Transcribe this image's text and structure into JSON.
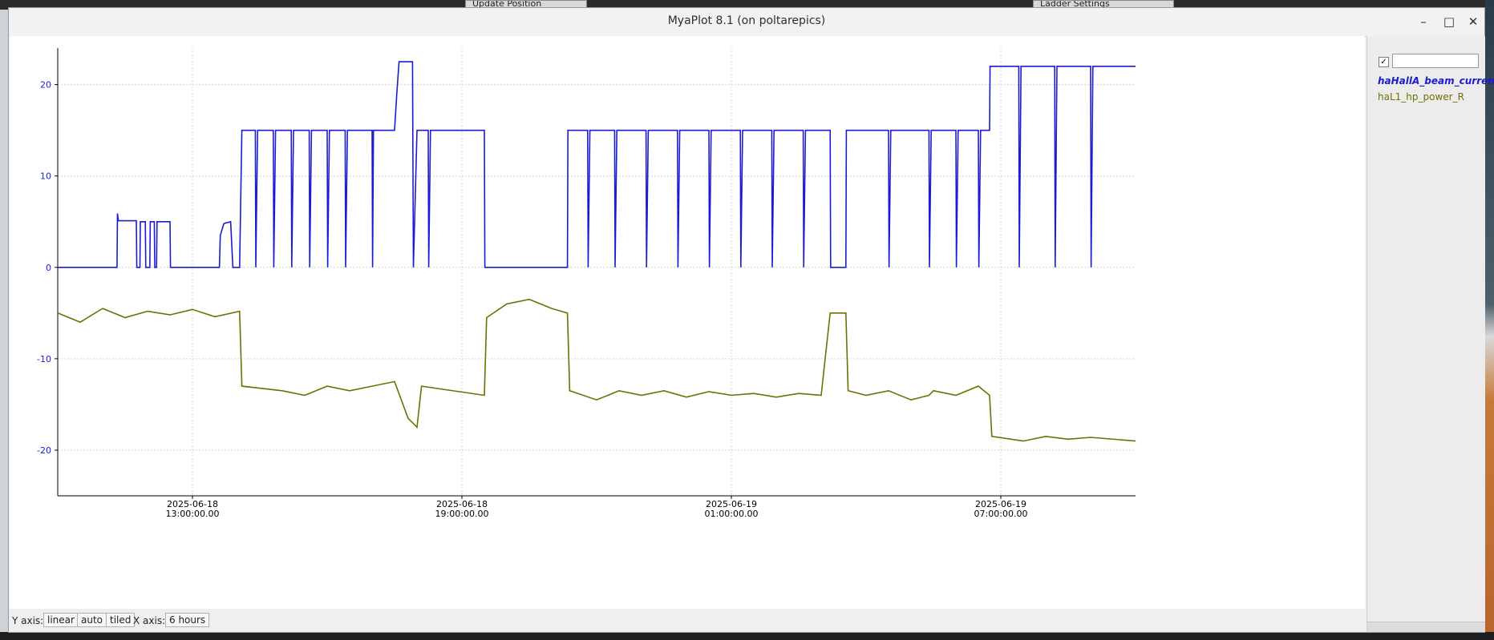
{
  "window": {
    "title": "MyaPlot 8.1 (on poltarepics)",
    "minimize_label": "–",
    "maximize_label": "□",
    "close_label": "✕"
  },
  "background": {
    "update_position_label": "Update Position",
    "ladder_settings_label": "Ladder Settings"
  },
  "legend": {
    "checked": true,
    "check_glyph": "✓",
    "filter_value": "",
    "items": [
      {
        "label": "haHallA_beam_curren",
        "color": "#1c1ccf",
        "selected": true
      },
      {
        "label": "haL1_hp_power_R",
        "color": "#707000",
        "selected": false
      }
    ]
  },
  "status": {
    "y_axis_label": "Y axis:",
    "y_scale": "linear",
    "y_range": "auto",
    "y_layout": "tiled",
    "x_axis_label": "X axis:",
    "x_span": "6 hours"
  },
  "chart_data": {
    "type": "line",
    "grid": true,
    "x_unit": "hours since 2025-06-18 10:00",
    "xlim": [
      0,
      24
    ],
    "ylim": [
      -25,
      24
    ],
    "y_ticks": [
      -20,
      -10,
      0,
      10,
      20
    ],
    "x_ticks": [
      {
        "x": 3,
        "date": "2025-06-18",
        "time": "13:00:00.00"
      },
      {
        "x": 9,
        "date": "2025-06-18",
        "time": "19:00:00.00"
      },
      {
        "x": 15,
        "date": "2025-06-19",
        "time": "01:00:00.00"
      },
      {
        "x": 21,
        "date": "2025-06-19",
        "time": "07:00:00.00"
      }
    ],
    "series": [
      {
        "name": "haHallA_beam_curren",
        "color": "#1c1ccf",
        "points": [
          [
            0,
            0
          ],
          [
            1.32,
            0
          ],
          [
            1.33,
            5.9
          ],
          [
            1.35,
            5.1
          ],
          [
            1.75,
            5.1
          ],
          [
            1.76,
            0
          ],
          [
            1.83,
            0
          ],
          [
            1.84,
            5
          ],
          [
            1.95,
            5
          ],
          [
            1.96,
            0
          ],
          [
            2.05,
            0
          ],
          [
            2.06,
            5
          ],
          [
            2.15,
            5
          ],
          [
            2.16,
            0
          ],
          [
            2.2,
            0
          ],
          [
            2.21,
            5
          ],
          [
            2.5,
            5
          ],
          [
            2.51,
            0
          ],
          [
            3.6,
            0
          ],
          [
            3.62,
            3.5
          ],
          [
            3.7,
            4.8
          ],
          [
            3.85,
            5
          ],
          [
            3.9,
            0
          ],
          [
            4.05,
            0
          ],
          [
            4.1,
            15
          ],
          [
            4.4,
            15
          ],
          [
            4.41,
            0
          ],
          [
            4.45,
            15
          ],
          [
            4.8,
            15
          ],
          [
            4.81,
            0
          ],
          [
            4.85,
            15
          ],
          [
            5.2,
            15
          ],
          [
            5.21,
            0
          ],
          [
            5.25,
            15
          ],
          [
            5.6,
            15
          ],
          [
            5.61,
            0
          ],
          [
            5.65,
            15
          ],
          [
            6.0,
            15
          ],
          [
            6.01,
            0
          ],
          [
            6.05,
            15
          ],
          [
            6.4,
            15
          ],
          [
            6.41,
            0
          ],
          [
            6.45,
            15
          ],
          [
            7.0,
            15
          ],
          [
            7.01,
            0
          ],
          [
            7.03,
            15
          ],
          [
            7.5,
            15
          ],
          [
            7.55,
            19
          ],
          [
            7.6,
            22.5
          ],
          [
            7.9,
            22.5
          ],
          [
            7.92,
            0
          ],
          [
            8.0,
            15
          ],
          [
            8.25,
            15
          ],
          [
            8.26,
            0
          ],
          [
            8.3,
            15
          ],
          [
            9.5,
            15
          ],
          [
            9.51,
            0
          ],
          [
            11.35,
            0
          ],
          [
            11.36,
            15
          ],
          [
            11.8,
            15
          ],
          [
            11.81,
            0
          ],
          [
            11.85,
            15
          ],
          [
            12.4,
            15
          ],
          [
            12.41,
            0
          ],
          [
            12.45,
            15
          ],
          [
            13.1,
            15
          ],
          [
            13.11,
            0
          ],
          [
            13.15,
            15
          ],
          [
            13.8,
            15
          ],
          [
            13.81,
            0
          ],
          [
            13.85,
            15
          ],
          [
            14.5,
            15
          ],
          [
            14.51,
            0
          ],
          [
            14.55,
            15
          ],
          [
            15.2,
            15
          ],
          [
            15.21,
            0
          ],
          [
            15.25,
            15
          ],
          [
            15.9,
            15
          ],
          [
            15.91,
            0
          ],
          [
            15.95,
            15
          ],
          [
            16.6,
            15
          ],
          [
            16.61,
            0
          ],
          [
            16.65,
            15
          ],
          [
            17.2,
            15
          ],
          [
            17.21,
            0
          ],
          [
            17.55,
            0
          ],
          [
            17.56,
            15
          ],
          [
            18.5,
            15
          ],
          [
            18.51,
            0
          ],
          [
            18.55,
            15
          ],
          [
            19.4,
            15
          ],
          [
            19.41,
            0
          ],
          [
            19.45,
            15
          ],
          [
            20.0,
            15
          ],
          [
            20.01,
            0
          ],
          [
            20.05,
            15
          ],
          [
            20.5,
            15
          ],
          [
            20.51,
            0
          ],
          [
            20.55,
            15
          ],
          [
            20.75,
            15
          ],
          [
            20.76,
            22
          ],
          [
            21.4,
            22
          ],
          [
            21.41,
            0
          ],
          [
            21.45,
            22
          ],
          [
            22.2,
            22
          ],
          [
            22.21,
            0
          ],
          [
            22.25,
            22
          ],
          [
            23.0,
            22
          ],
          [
            23.01,
            0
          ],
          [
            23.05,
            22
          ],
          [
            24,
            22
          ]
        ]
      },
      {
        "name": "haL1_hp_power_R",
        "color": "#707000",
        "points": [
          [
            0,
            -5
          ],
          [
            0.5,
            -6
          ],
          [
            1.0,
            -4.5
          ],
          [
            1.5,
            -5.5
          ],
          [
            2.0,
            -4.8
          ],
          [
            2.5,
            -5.2
          ],
          [
            3.0,
            -4.6
          ],
          [
            3.5,
            -5.4
          ],
          [
            4.05,
            -4.8
          ],
          [
            4.1,
            -13
          ],
          [
            5.0,
            -13.5
          ],
          [
            5.5,
            -14
          ],
          [
            6.0,
            -13
          ],
          [
            6.5,
            -13.5
          ],
          [
            7.0,
            -13
          ],
          [
            7.5,
            -12.5
          ],
          [
            7.8,
            -16.5
          ],
          [
            8.0,
            -17.5
          ],
          [
            8.1,
            -13
          ],
          [
            9.5,
            -14
          ],
          [
            9.55,
            -5.5
          ],
          [
            10.0,
            -4
          ],
          [
            10.5,
            -3.5
          ],
          [
            11.0,
            -4.5
          ],
          [
            11.35,
            -5
          ],
          [
            11.4,
            -13.5
          ],
          [
            12.0,
            -14.5
          ],
          [
            12.5,
            -13.5
          ],
          [
            13.0,
            -14
          ],
          [
            13.5,
            -13.5
          ],
          [
            14.0,
            -14.2
          ],
          [
            14.5,
            -13.6
          ],
          [
            15.0,
            -14
          ],
          [
            15.5,
            -13.8
          ],
          [
            16.0,
            -14.2
          ],
          [
            16.5,
            -13.8
          ],
          [
            17.0,
            -14
          ],
          [
            17.2,
            -5
          ],
          [
            17.55,
            -5
          ],
          [
            17.6,
            -13.5
          ],
          [
            18.0,
            -14
          ],
          [
            18.5,
            -13.5
          ],
          [
            19.0,
            -14.5
          ],
          [
            19.4,
            -14
          ],
          [
            19.5,
            -13.5
          ],
          [
            20.0,
            -14
          ],
          [
            20.5,
            -13
          ],
          [
            20.75,
            -14
          ],
          [
            20.8,
            -18.5
          ],
          [
            21.5,
            -19
          ],
          [
            22.0,
            -18.5
          ],
          [
            22.5,
            -18.8
          ],
          [
            23.0,
            -18.6
          ],
          [
            24,
            -19
          ]
        ]
      }
    ]
  }
}
